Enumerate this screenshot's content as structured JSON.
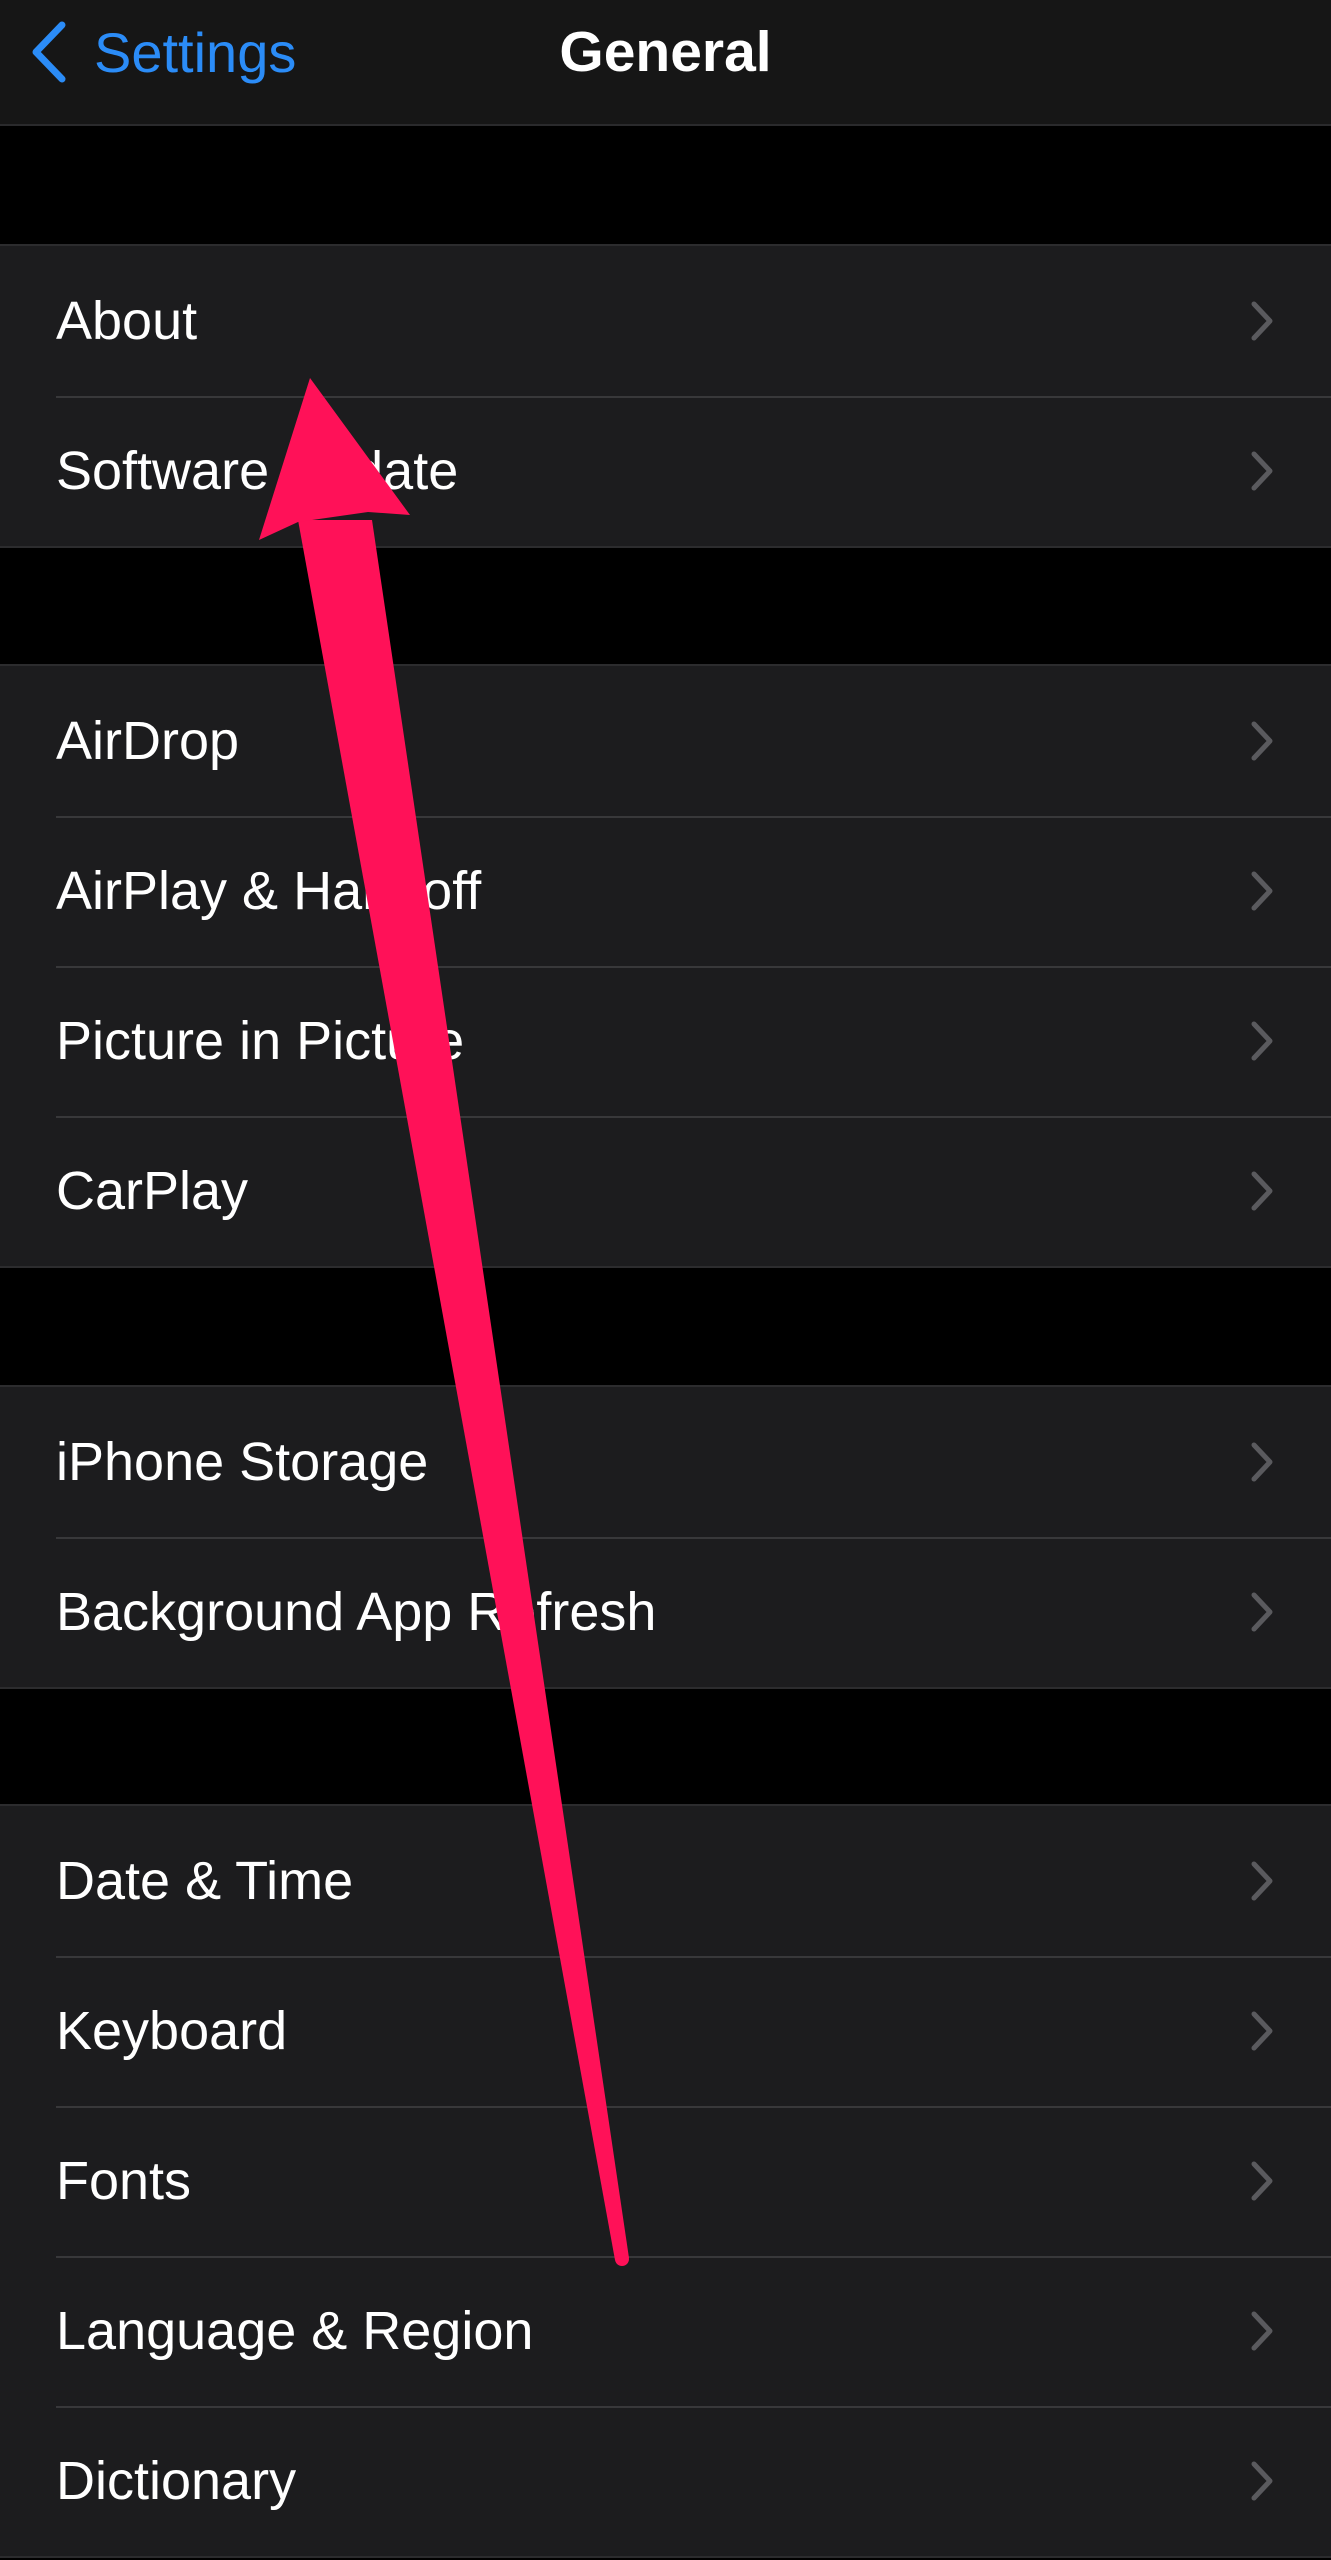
{
  "navbar": {
    "back_label": "Settings",
    "back_icon": "chevron-left-icon",
    "title": "General"
  },
  "colors": {
    "accent": "#2b8cf7",
    "annotation_arrow": "#ff1158",
    "row_background": "#1c1c1e",
    "page_background": "#000000"
  },
  "groups": [
    {
      "items": [
        {
          "label": "About"
        },
        {
          "label": "Software Update"
        }
      ]
    },
    {
      "items": [
        {
          "label": "AirDrop"
        },
        {
          "label": "AirPlay & Handoff"
        },
        {
          "label": "Picture in Picture"
        },
        {
          "label": "CarPlay"
        }
      ]
    },
    {
      "items": [
        {
          "label": "iPhone Storage"
        },
        {
          "label": "Background App Refresh"
        }
      ]
    },
    {
      "items": [
        {
          "label": "Date & Time"
        },
        {
          "label": "Keyboard"
        },
        {
          "label": "Fonts"
        },
        {
          "label": "Language & Region"
        },
        {
          "label": "Dictionary"
        }
      ]
    }
  ],
  "annotation": {
    "type": "arrow",
    "points_to": "About"
  }
}
